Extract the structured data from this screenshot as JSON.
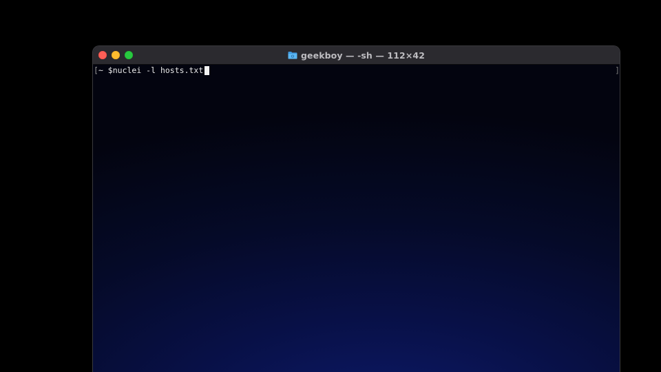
{
  "window": {
    "title": "geekboy — -sh — 112×42",
    "folder_icon": "folder-icon"
  },
  "terminal": {
    "left_mark": "[",
    "prompt": "~ $",
    "command": "nuclei -l hosts.txt",
    "right_mark": "]"
  },
  "colors": {
    "close": "#fe5f57",
    "minimize": "#febc2e",
    "zoom": "#28c840",
    "folder": "#4aa8e8"
  }
}
